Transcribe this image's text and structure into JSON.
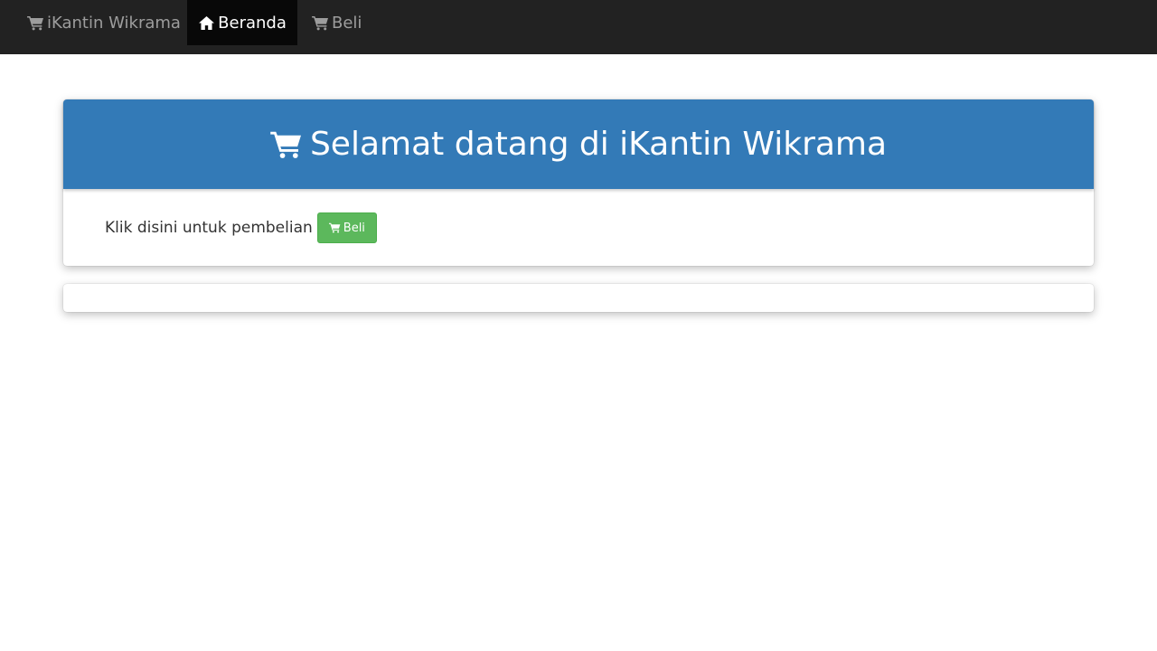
{
  "navbar": {
    "brand": {
      "label": "iKantin Wikrama",
      "icon": "shopping-cart-icon"
    },
    "items": [
      {
        "label": "Beranda",
        "icon": "home-icon",
        "active": true
      },
      {
        "label": "Beli",
        "icon": "shopping-cart-icon",
        "active": false
      }
    ]
  },
  "hero": {
    "title": "Selamat datang di iKantin Wikrama",
    "icon": "shopping-cart-icon",
    "body_text": "Klik disini untuk pembelian",
    "button_label": "Beli",
    "button_icon": "shopping-cart-icon"
  },
  "colors": {
    "navbar_bg": "#222222",
    "navbar_active_bg": "#080808",
    "panel_heading": "#337ab7",
    "button_success": "#5cb85c"
  }
}
